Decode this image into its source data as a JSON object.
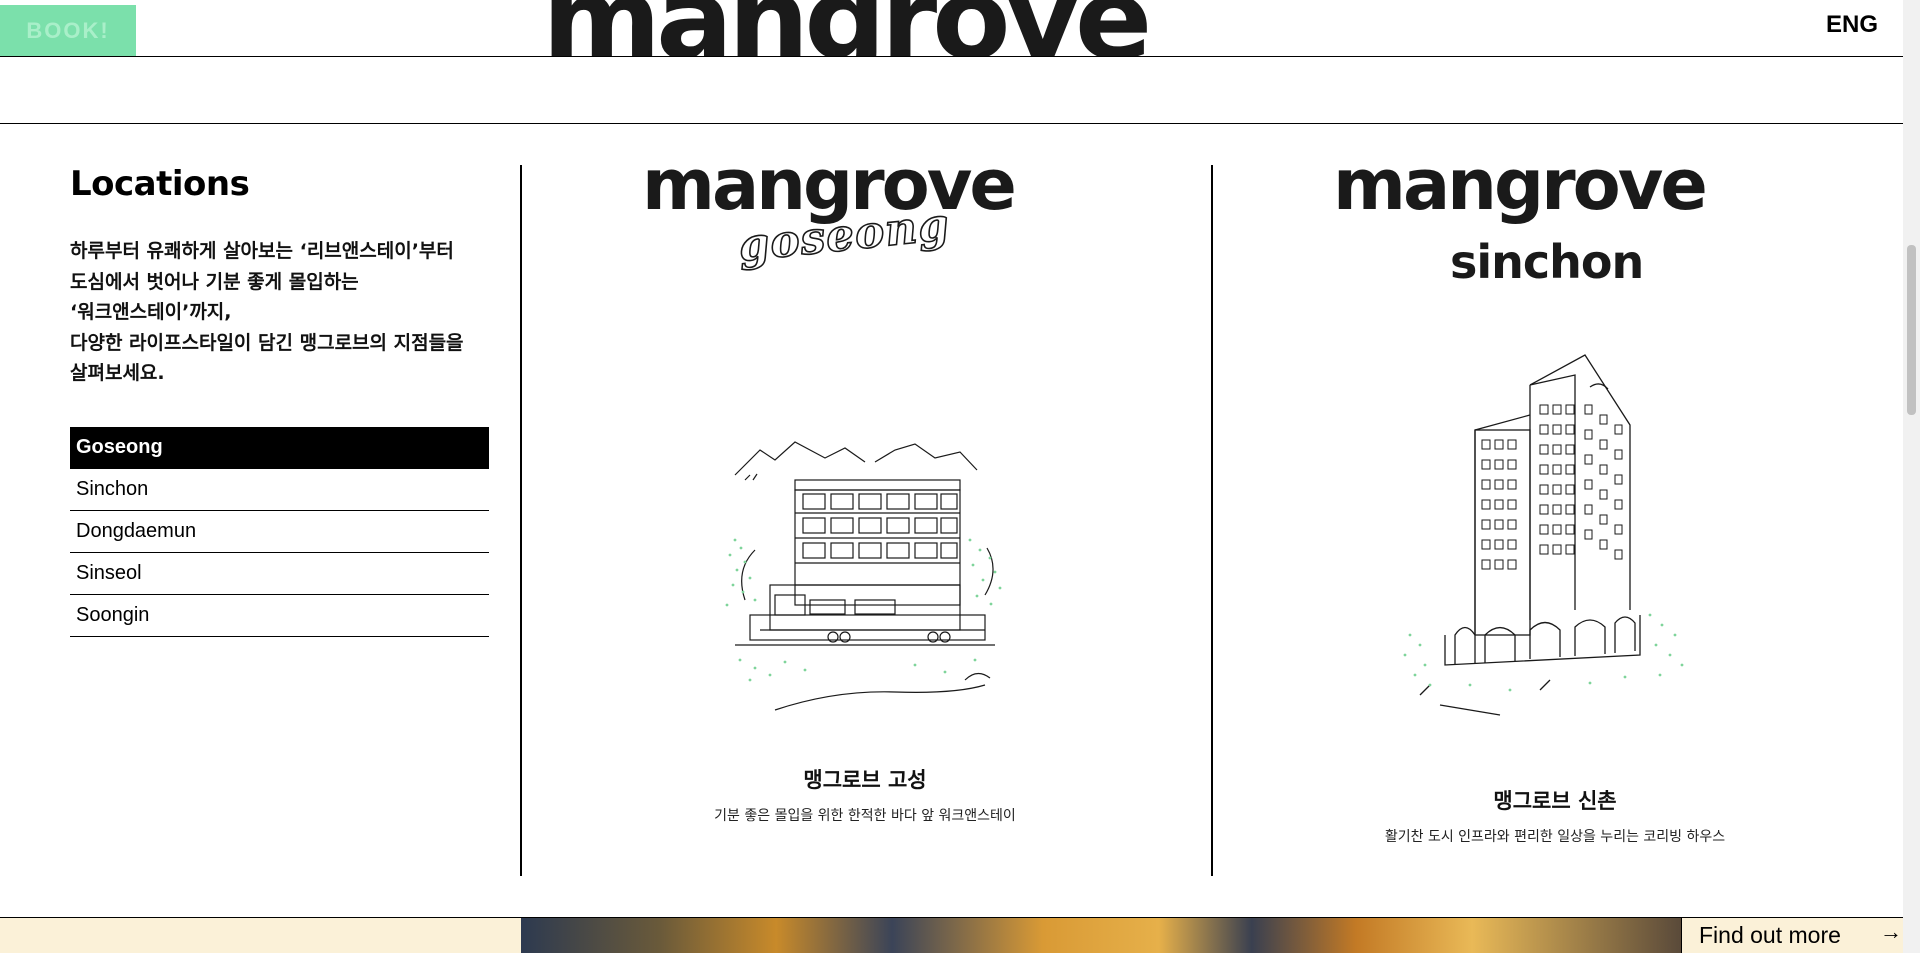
{
  "header": {
    "book_label": "BOOK!",
    "logo": "mangrove",
    "lang_label": "ENG"
  },
  "locations": {
    "title": "Locations",
    "description_lines": [
      "하루부터 유쾌하게 살아보는 ‘리브앤스테이’부터",
      "도심에서 벗어나 기분 좋게 몰입하는",
      "‘워크앤스테이’까지,",
      "다양한 라이프스타일이 담긴 맹그로브의 지점들을",
      "살펴보세요."
    ],
    "items": [
      {
        "label": "Goseong",
        "active": true
      },
      {
        "label": "Sinchon",
        "active": false
      },
      {
        "label": "Dongdaemun",
        "active": false
      },
      {
        "label": "Sinseol",
        "active": false
      },
      {
        "label": "Soongin",
        "active": false
      }
    ]
  },
  "cards": [
    {
      "logo": "mangrove",
      "sub": "goseong",
      "name": "맹그로브 고성",
      "desc": "기분 좋은 몰입을 위한 한적한 바다 앞 워크앤스테이",
      "illustration": "goseong-building-illustration"
    },
    {
      "logo": "mangrove",
      "sub": "sinchon",
      "name": "맹그로브 신촌",
      "desc": "활기찬 도시 인프라와 편리한 일상을 누리는 코리빙 하우스",
      "illustration": "sinchon-tower-illustration"
    }
  ],
  "footer": {
    "find_more_label": "Find out more",
    "arrow": "→"
  },
  "colors": {
    "book_button": "#7be0ab",
    "active_item_bg": "#000000",
    "bottom_strip_bg": "#fbf1d8",
    "illustration_green": "#7fd49a"
  }
}
